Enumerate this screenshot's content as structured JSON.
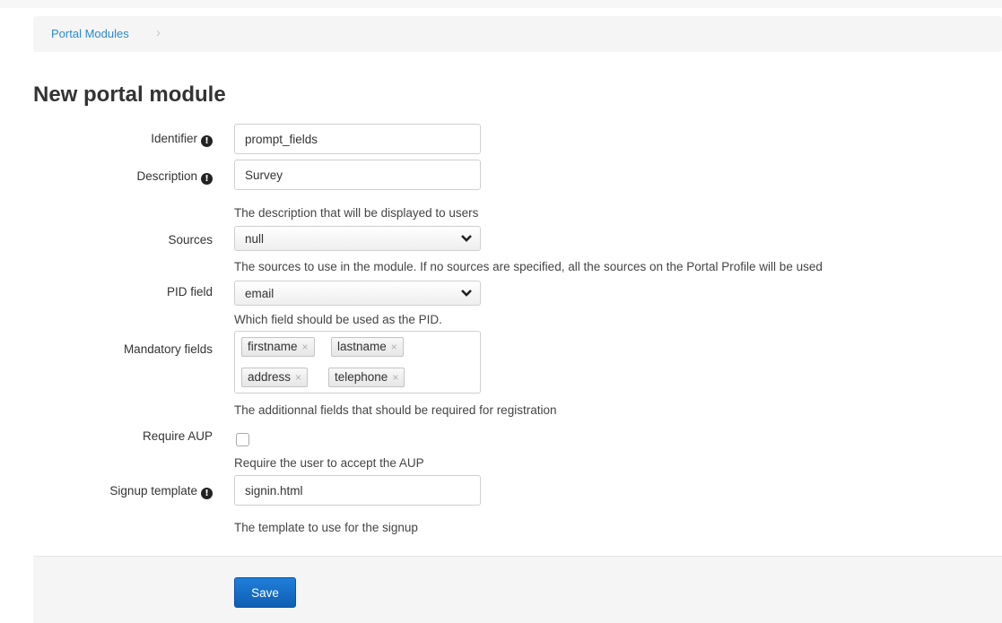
{
  "breadcrumb": {
    "link": "Portal Modules",
    "separator": "›"
  },
  "page_title": "New portal module",
  "fields": {
    "identifier": {
      "label": "Identifier",
      "value": "prompt_fields"
    },
    "description": {
      "label": "Description",
      "value": "Survey",
      "help": "The description that will be displayed to users"
    },
    "sources": {
      "label": "Sources",
      "value": "null",
      "help": "The sources to use in the module. If no sources are specified, all the sources on the Portal Profile will be used"
    },
    "pid_field": {
      "label": "PID field",
      "value": "email",
      "help": "Which field should be used as the PID."
    },
    "mandatory_fields": {
      "label": "Mandatory fields",
      "tags": [
        "firstname",
        "lastname",
        "address",
        "telephone"
      ],
      "remove_glyph": "×",
      "help": "The additionnal fields that should be required for registration"
    },
    "require_aup": {
      "label": "Require AUP",
      "checked": false,
      "help": "Require the user to accept the AUP"
    },
    "signup_template": {
      "label": "Signup template",
      "value": "signin.html",
      "help": "The template to use for the signup"
    }
  },
  "info_glyph": "!",
  "actions": {
    "save_label": "Save"
  },
  "colors": {
    "link": "#2a8bcc",
    "primary_button": "#1a73c9",
    "panel_bg": "#f5f5f5"
  }
}
